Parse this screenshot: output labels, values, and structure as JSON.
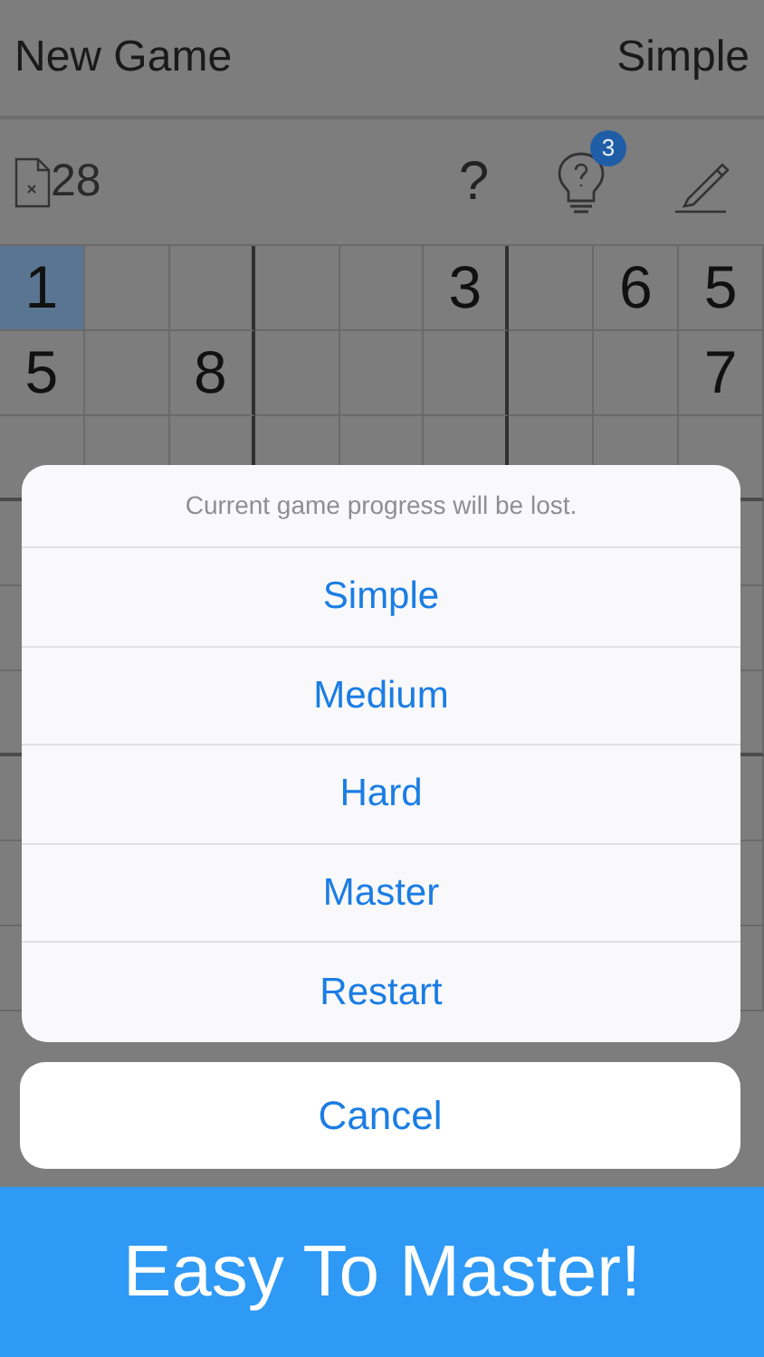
{
  "header": {
    "left": "New Game",
    "right": "Simple"
  },
  "toolbar": {
    "mistakes": "28",
    "help": "?",
    "hint_badge": "3"
  },
  "grid": {
    "rows": [
      [
        {
          "value": "1",
          "selected": true
        },
        {
          "selected": false
        },
        {
          "selected": false
        },
        {
          "selected": false
        },
        {
          "selected": false
        },
        {
          "value": "3",
          "selected": false
        },
        {
          "selected": false
        },
        {
          "value": "6",
          "selected": false
        },
        {
          "value": "5",
          "selected": false
        }
      ],
      [
        {
          "value": "5",
          "selected": false
        },
        {
          "selected": false
        },
        {
          "value": "8",
          "selected": false
        },
        {
          "selected": false
        },
        {
          "selected": false
        },
        {
          "selected": false
        },
        {
          "selected": false
        },
        {
          "selected": false
        },
        {
          "value": "7",
          "selected": false
        }
      ]
    ]
  },
  "action_sheet": {
    "message": "Current game progress will be lost.",
    "options": [
      "Simple",
      "Medium",
      "Hard",
      "Master",
      "Restart"
    ],
    "cancel": "Cancel"
  },
  "banner": "Easy To Master!"
}
